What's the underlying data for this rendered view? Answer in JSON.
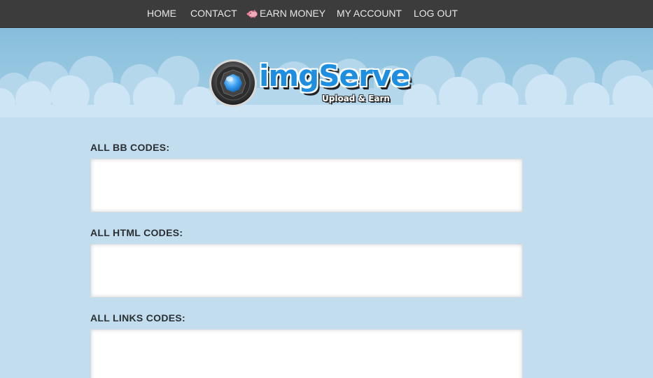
{
  "nav": {
    "items": [
      {
        "label": "HOME"
      },
      {
        "label": "CONTACT"
      },
      {
        "label": "EARN MONEY",
        "icon": "piggy-bank-icon"
      },
      {
        "label": "MY ACCOUNT"
      },
      {
        "label": "LOG OUT"
      }
    ]
  },
  "logo": {
    "name": "imgServe",
    "tagline": "Upload & Earn"
  },
  "sections": [
    {
      "label": "ALL BB CODES:",
      "value": ""
    },
    {
      "label": "ALL HTML CODES:",
      "value": ""
    },
    {
      "label": "ALL LINKS CODES:",
      "value": ""
    }
  ],
  "colors": {
    "nav_background": "#3c3c3c",
    "page_background": "#c2ddee",
    "sky": "#8cc0dc",
    "logo_blue": "#1e8fe0"
  }
}
